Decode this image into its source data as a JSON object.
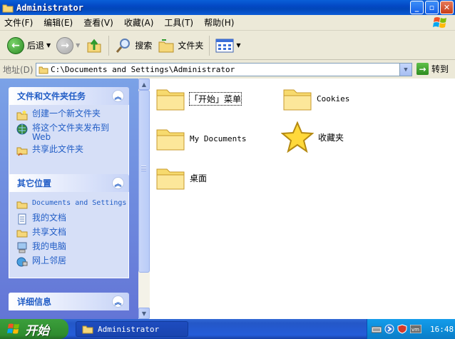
{
  "window": {
    "title": "Administrator"
  },
  "menu": [
    "文件(F)",
    "编辑(E)",
    "查看(V)",
    "收藏(A)",
    "工具(T)",
    "帮助(H)"
  ],
  "toolbar": {
    "back": "后退",
    "search": "搜索",
    "folders": "文件夹"
  },
  "address": {
    "label": "地址(D)",
    "path": "C:\\Documents and Settings\\Administrator",
    "go": "转到"
  },
  "file_tasks": {
    "title": "文件和文件夹任务",
    "items": [
      "创建一个新文件夹",
      "将这个文件夹发布到 Web",
      "共享此文件夹"
    ]
  },
  "other_places": {
    "title": "其它位置",
    "items": [
      "Documents and Settings",
      "我的文档",
      "共享文档",
      "我的电脑",
      "网上邻居"
    ]
  },
  "details": {
    "title": "详细信息"
  },
  "files": [
    "「开始」菜单",
    "Cookies",
    "My Documents",
    "收藏夹",
    "桌面"
  ],
  "taskbar": {
    "start": "开始",
    "task": "Administrator",
    "clock": "16:48"
  }
}
